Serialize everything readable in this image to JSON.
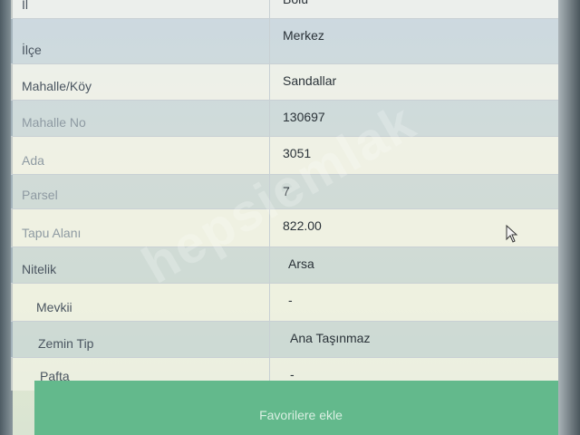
{
  "rows": [
    {
      "label": "İl",
      "value": "Bolu"
    },
    {
      "label": "İlçe",
      "value": "Merkez"
    },
    {
      "label": "Mahalle/Köy",
      "value": "Sandallar"
    },
    {
      "label": "Mahalle No",
      "value": "130697"
    },
    {
      "label": "Ada",
      "value": "3051"
    },
    {
      "label": "Parsel",
      "value": "7"
    },
    {
      "label": "Tapu Alanı",
      "value": "822.00"
    },
    {
      "label": "Nitelik",
      "value": "Arsa"
    },
    {
      "label": "Mevkii",
      "value": "-"
    },
    {
      "label": "Zemin Tip",
      "value": "Ana Taşınmaz"
    },
    {
      "label": "Pafta",
      "value": "-"
    }
  ],
  "button": {
    "label": "Favorilere ekle"
  },
  "watermark": {
    "text": "hepsiemlak"
  }
}
